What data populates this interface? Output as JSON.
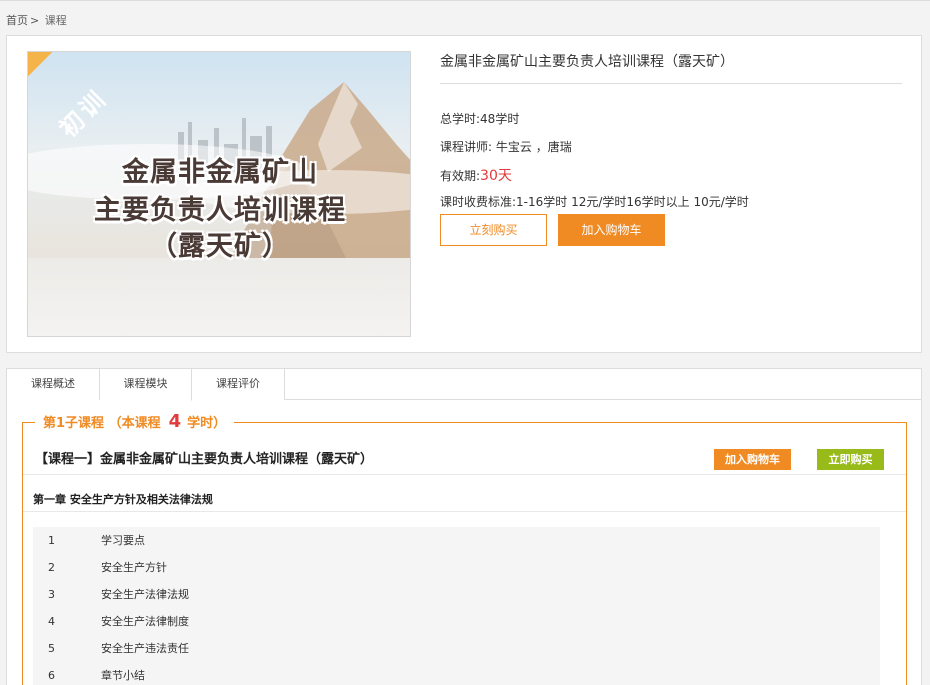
{
  "breadcrumb": {
    "home": "首页",
    "separator": ">",
    "current": "课程"
  },
  "cover": {
    "badge": "初训",
    "title_lines": [
      "金属非金属矿山",
      "主要负责人培训课程",
      "（露天矿）"
    ]
  },
  "course": {
    "title": "金属非金属矿山主要负责人培训课程（露天矿）",
    "total_hours": "总学时:48学时",
    "teacher_label": "课程讲师:",
    "teacher_names": "牛宝云 ，唐瑞",
    "valid_label": "有效期:",
    "valid_value": "30天",
    "fee": "课时收费标准:1-16学时 12元/学时16学时以上 10元/学时",
    "buy_label": "立刻购买",
    "cart_label": "加入购物车"
  },
  "tabs": [
    {
      "label": "课程概述"
    },
    {
      "label": "课程模块"
    },
    {
      "label": "课程评价"
    }
  ],
  "module": {
    "legend_prefix": "第1子课程",
    "legend_open": "（本课程",
    "legend_hours": "4",
    "legend_suffix": "学时）",
    "course_name": "【课程一】金属非金属矿山主要负责人培训课程（露天矿）",
    "cart_label": "加入购物车",
    "buy_label": "立即购买",
    "chapter": "第一章 安全生产方针及相关法律法规",
    "lessons": [
      {
        "no": "1",
        "title": "学习要点"
      },
      {
        "no": "2",
        "title": "安全生产方针"
      },
      {
        "no": "3",
        "title": "安全生产法律法规"
      },
      {
        "no": "4",
        "title": "安全生产法律制度"
      },
      {
        "no": "5",
        "title": "安全生产违法责任"
      },
      {
        "no": "6",
        "title": "章节小结"
      }
    ]
  },
  "colors": {
    "accent": "#f08a23",
    "price_red": "#e4393c",
    "buy_green": "#99bb1a",
    "badge_orange": "#f5b44a"
  }
}
